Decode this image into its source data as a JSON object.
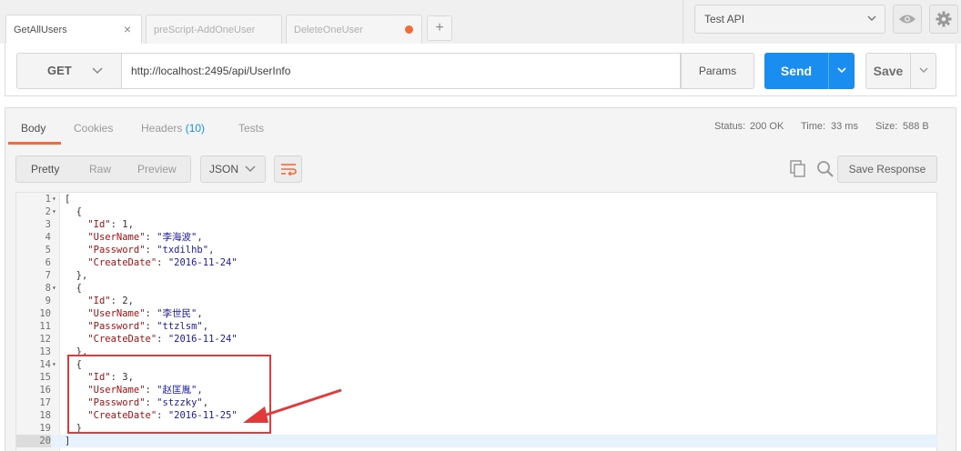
{
  "tabs": [
    {
      "label": "GetAllUsers",
      "active": true,
      "marker": "close"
    },
    {
      "label": "preScript-AddOneUser",
      "active": false
    },
    {
      "label": "DeleteOneUser",
      "active": false,
      "marker": "unsaved-dot"
    }
  ],
  "tab_add_label": "+",
  "environment": {
    "selected": "Test API"
  },
  "request": {
    "method": "GET",
    "url": "http://localhost:2495/api/UserInfo",
    "params_label": "Params",
    "send_label": "Send",
    "save_label": "Save"
  },
  "response": {
    "tabs": [
      {
        "label": "Body",
        "active": true
      },
      {
        "label": "Cookies",
        "active": false
      },
      {
        "label": "Headers",
        "count": "(10)",
        "active": false
      },
      {
        "label": "Tests",
        "active": false
      }
    ],
    "status_label": "Status:",
    "status_value": "200 OK",
    "time_label": "Time:",
    "time_value": "33 ms",
    "size_label": "Size:",
    "size_value": "588 B",
    "view_modes": [
      "Pretty",
      "Raw",
      "Preview"
    ],
    "active_view": "Pretty",
    "format": "JSON",
    "save_response_label": "Save Response"
  },
  "code_lines": [
    {
      "n": "1",
      "fold": true,
      "text": "["
    },
    {
      "n": "2",
      "fold": true,
      "text": "  {"
    },
    {
      "n": "3",
      "key": "\"Id\"",
      "num": "1"
    },
    {
      "n": "4",
      "key": "\"UserName\"",
      "str": "\"李海波\""
    },
    {
      "n": "5",
      "key": "\"Password\"",
      "str": "\"txdilhb\""
    },
    {
      "n": "6",
      "key": "\"CreateDate\"",
      "str": "\"2016-11-24\"",
      "last": true
    },
    {
      "n": "7",
      "text": "  },"
    },
    {
      "n": "8",
      "fold": true,
      "text": "  {"
    },
    {
      "n": "9",
      "key": "\"Id\"",
      "num": "2"
    },
    {
      "n": "10",
      "key": "\"UserName\"",
      "str": "\"李世民\""
    },
    {
      "n": "11",
      "key": "\"Password\"",
      "str": "\"ttzlsm\""
    },
    {
      "n": "12",
      "key": "\"CreateDate\"",
      "str": "\"2016-11-24\"",
      "last": true
    },
    {
      "n": "13",
      "text": "  },"
    },
    {
      "n": "14",
      "fold": true,
      "text": "  {"
    },
    {
      "n": "15",
      "key": "\"Id\"",
      "num": "3"
    },
    {
      "n": "16",
      "key": "\"UserName\"",
      "str": "\"赵匡胤\""
    },
    {
      "n": "17",
      "key": "\"Password\"",
      "str": "\"stzzky\""
    },
    {
      "n": "18",
      "key": "\"CreateDate\"",
      "str": "\"2016-11-25\"",
      "last": true
    },
    {
      "n": "19",
      "text": "  }"
    },
    {
      "n": "20",
      "text": "]",
      "active": true
    }
  ],
  "icons": {
    "settings": "gear-icon",
    "preview": "eye-icon",
    "copy": "copy-icon",
    "search": "search-icon",
    "wrap": "wrap-lines-icon"
  },
  "colors": {
    "accent_blue": "#1a8ef0",
    "accent_orange": "#f26b3a",
    "annotation_red": "#e23a3a"
  }
}
